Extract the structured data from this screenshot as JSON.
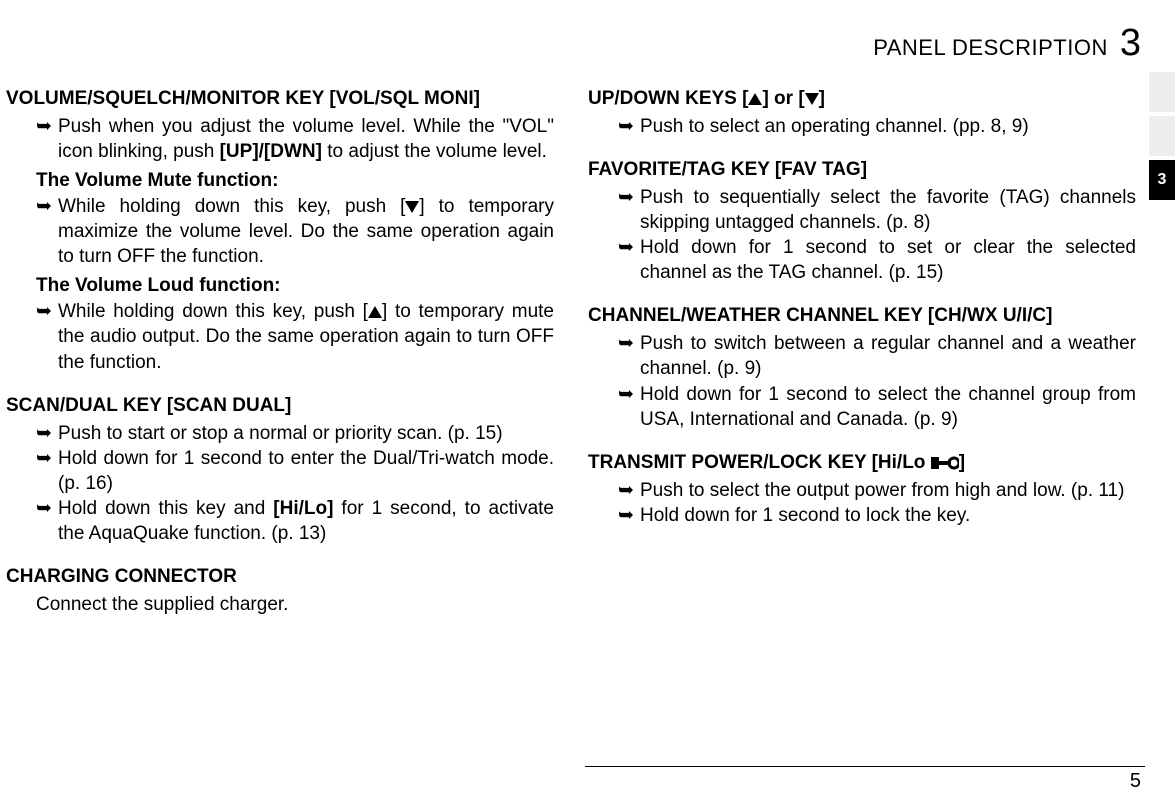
{
  "header": {
    "title": "PANEL DESCRIPTION",
    "chapter": "3"
  },
  "side_tab_active": "3",
  "left": {
    "s1": {
      "title": "VOLUME/SQUELCH/MONITOR KEY [VOL/SQL MONI]",
      "b1a": "Push when you adjust the volume level. While the \"VOL\" icon blinking, push ",
      "b1b": "[UP]/[DWN]",
      "b1c": " to adjust the volume level.",
      "sub1": "The Volume Mute function:",
      "b2a": "While holding down this key, push [",
      "b2b": "] to temporary maximize the volume level. Do the same operation again to turn OFF the function.",
      "sub2": "The Volume Loud function:",
      "b3a": "While holding down this key, push [",
      "b3b": "] to temporary mute the audio output. Do the same operation again to turn OFF the function."
    },
    "s2": {
      "title": "SCAN/DUAL KEY [SCAN DUAL]",
      "b1": "Push to start or stop a normal or priority scan. (p. 15)",
      "b2": "Hold down for 1 second to enter the Dual/Tri-watch mode. (p. 16)",
      "b3a": "Hold down this key and ",
      "b3b": "[Hi/Lo]",
      "b3c": " for 1 second, to activate the AquaQuake function. (p. 13)"
    },
    "s3": {
      "title": "CHARGING CONNECTOR",
      "body": "Connect the supplied charger."
    }
  },
  "right": {
    "s1": {
      "titleA": "UP/DOWN KEYS [",
      "titleB": "] or [",
      "titleC": "]",
      "b1": "Push to select an operating channel. (pp. 8, 9)"
    },
    "s2": {
      "title": "FAVORITE/TAG KEY [FAV TAG]",
      "b1": "Push to sequentially select the favorite (TAG) channels skipping untagged channels. (p. 8)",
      "b2": "Hold down for 1 second to set or clear the selected channel as the TAG channel. (p. 15)"
    },
    "s3": {
      "title": "CHANNEL/WEATHER CHANNEL KEY [CH/WX U/I/C]",
      "b1": "Push to switch between a regular channel and a weather channel. (p. 9)",
      "b2": "Hold down for 1 second to select the channel group from USA, International and Canada. (p. 9)"
    },
    "s4": {
      "titleA": "TRANSMIT POWER/LOCK KEY [Hi/Lo ",
      "titleB": "]",
      "b1": "Push to select the output power from high and low. (p. 11)",
      "b2": "Hold down for 1 second to lock the key."
    }
  },
  "page_number": "5",
  "arrow": "➥"
}
